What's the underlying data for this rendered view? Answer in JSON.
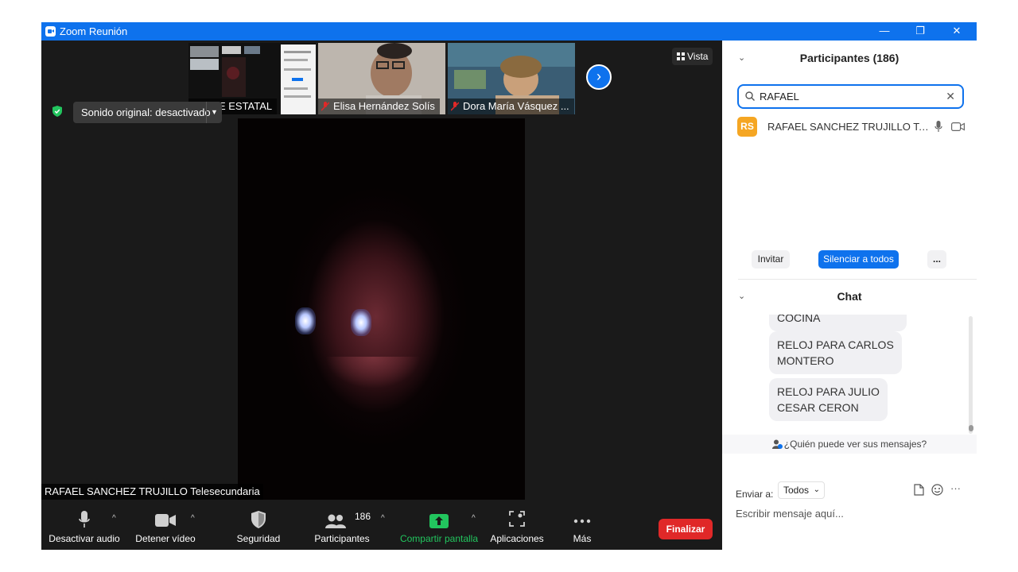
{
  "window": {
    "title": "Zoom Reunión",
    "minimize": "—",
    "maximize": "❐",
    "close": "✕"
  },
  "gallery": {
    "thumbs": [
      {
        "name": "SETSE ESTATAL",
        "muted": false
      },
      {
        "name": "Elisa Hernández Solís",
        "muted": true
      },
      {
        "name": "Dora María Vásquez ...",
        "muted": true
      }
    ],
    "next": "›"
  },
  "view_button": {
    "icon": "grid-icon",
    "label": "Vista"
  },
  "sound": {
    "label": "Sonido original: desactivado"
  },
  "speaker": {
    "name": "RAFAEL SANCHEZ TRUJILLO Telesecundaria"
  },
  "toolbar": {
    "audio": "Desactivar audio",
    "video": "Detener vídeo",
    "security": "Seguridad",
    "participants": "Participantes",
    "participants_count": "186",
    "share": "Compartir pantalla",
    "apps": "Aplicaciones",
    "more": "Más",
    "end": "Finalizar"
  },
  "participants_panel": {
    "title": "Participantes (186)",
    "search_value": "RAFAEL",
    "participant": {
      "initials": "RS",
      "name": "RAFAEL SANCHEZ TRUJILLO Teles..."
    },
    "invite": "Invitar",
    "mute_all": "Silenciar a todos",
    "more": "..."
  },
  "chat": {
    "title": "Chat",
    "messages": [
      "COCINA",
      "RELOJ PARA CARLOS\nMONTERO",
      "RELOJ PARA JULIO\nCESAR CERON"
    ],
    "who_sees": "¿Quién puede ver sus mensajes?",
    "send_to_label": "Enviar a:",
    "send_to_value": "Todos",
    "placeholder": "Escribir mensaje aquí..."
  },
  "colors": {
    "accent": "#0e72ed",
    "end": "#e02828",
    "share": "#22c55e",
    "avatar": "#f5a623"
  }
}
